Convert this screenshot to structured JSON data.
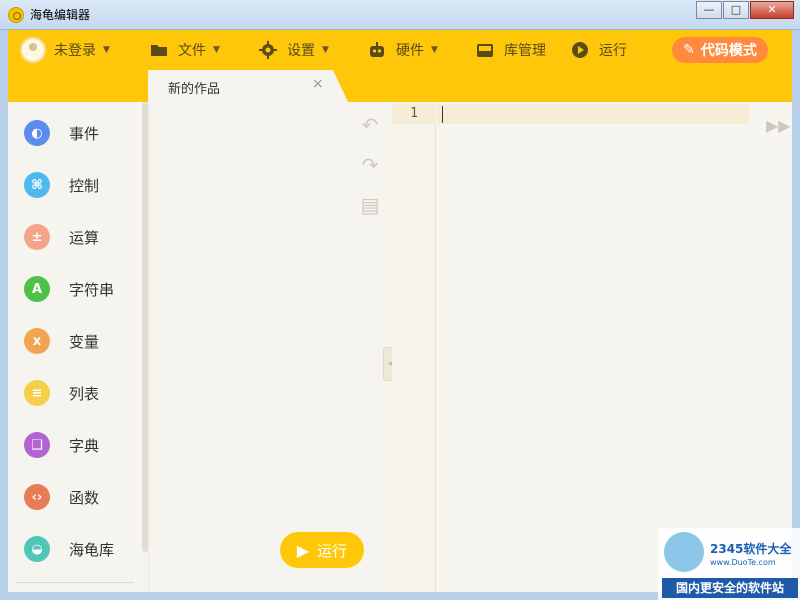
{
  "window": {
    "title": "海龟编辑器"
  },
  "toolbar": {
    "login": "未登录",
    "file": "文件",
    "settings": "设置",
    "hardware": "硬件",
    "library": "库管理",
    "run": "运行",
    "code_mode": "代码模式"
  },
  "tab": {
    "title": "新的作品",
    "close": "×"
  },
  "palette": {
    "items": [
      {
        "label": "事件",
        "icon": "toggle-icon",
        "color": "#5b8def"
      },
      {
        "label": "控制",
        "icon": "gamepad-icon",
        "color": "#4fb8f0"
      },
      {
        "label": "运算",
        "icon": "calculator-icon",
        "color": "#f5a48a"
      },
      {
        "label": "字符串",
        "icon": "letter-a-icon",
        "color": "#4fc04a"
      },
      {
        "label": "变量",
        "icon": "x-variable-icon",
        "color": "#f0a552"
      },
      {
        "label": "列表",
        "icon": "list-icon",
        "color": "#f5cf4a"
      },
      {
        "label": "字典",
        "icon": "book-icon",
        "color": "#b264d4"
      },
      {
        "label": "函数",
        "icon": "code-brackets-icon",
        "color": "#e87c55"
      },
      {
        "label": "海龟库",
        "icon": "turtle-icon",
        "color": "#4fc7b8"
      }
    ]
  },
  "workspace": {
    "run_label": "运行"
  },
  "editor": {
    "line_numbers": [
      "1"
    ]
  },
  "colors": {
    "toolbar": "#ffc70a",
    "code_mode": "#ff8a3d"
  },
  "watermark": {
    "brand": "2345软件大全",
    "url": "www.DuoTe.com",
    "slogan": "国内更安全的软件站"
  }
}
